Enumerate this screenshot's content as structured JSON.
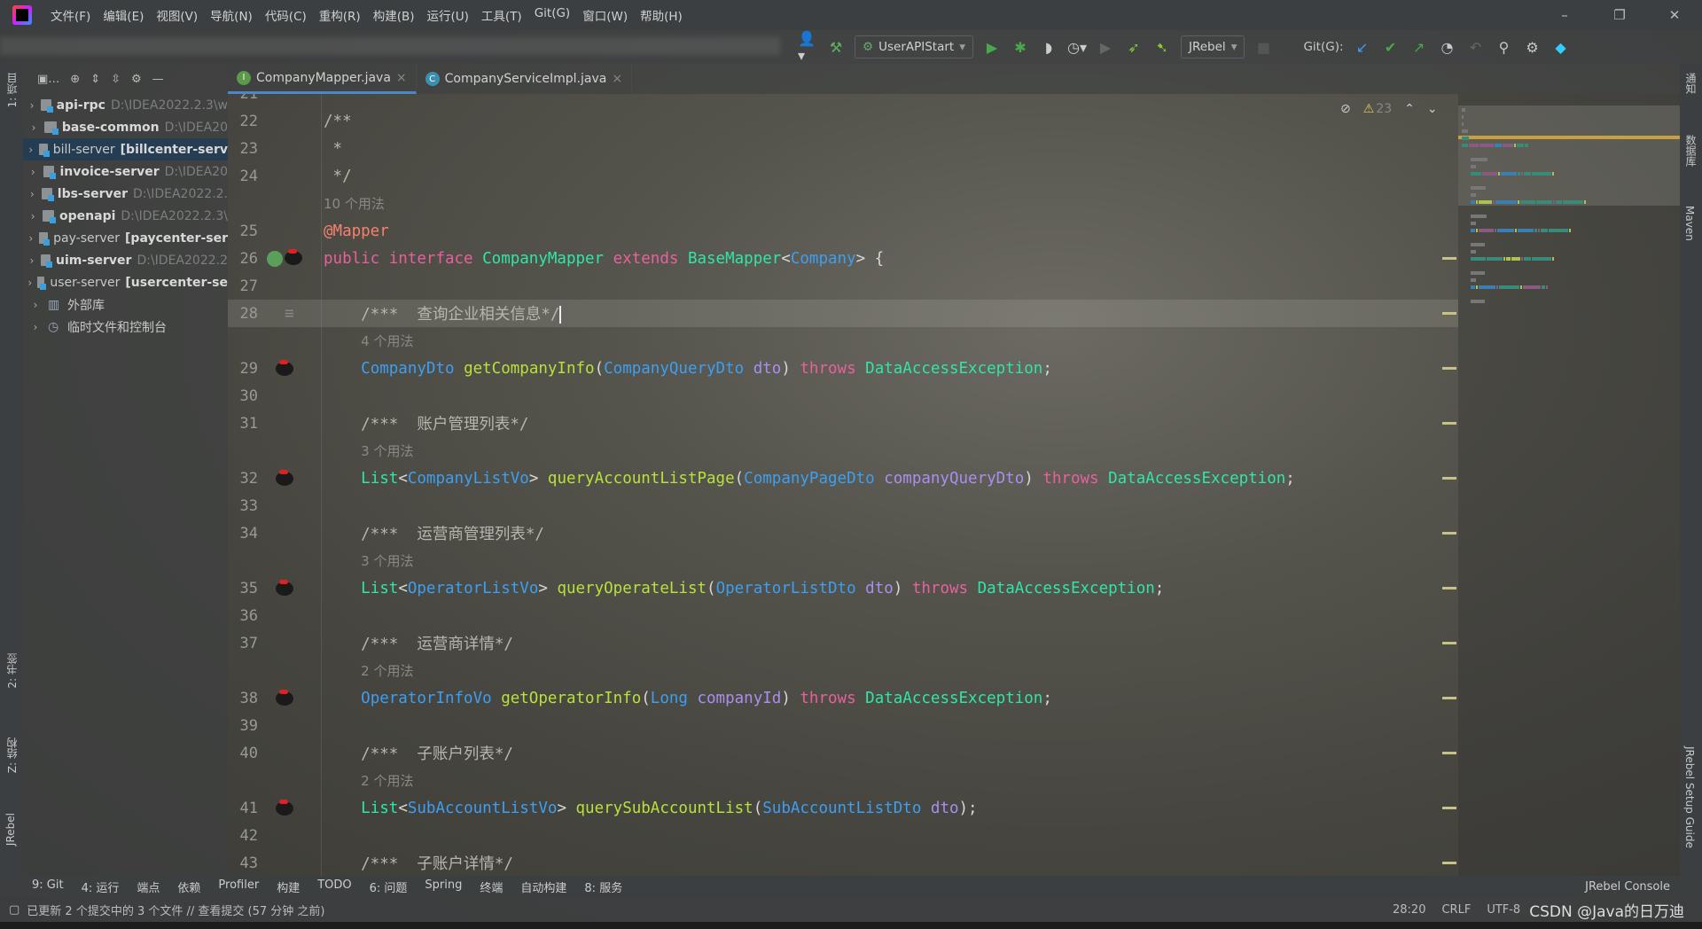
{
  "menu": [
    "文件(F)",
    "编辑(E)",
    "视图(V)",
    "导航(N)",
    "代码(C)",
    "重构(R)",
    "构建(B)",
    "运行(U)",
    "工具(T)",
    "Git(G)",
    "窗口(W)",
    "帮助(H)"
  ],
  "toolbar": {
    "run_config": "UserAPIStart",
    "jrebel": "JRebel",
    "git_label": "Git(G):"
  },
  "left_strip": {
    "project": "1: 项目",
    "bookmarks": "2: 书签",
    "structure": "Z: 结构",
    "jrebel": "JRebel"
  },
  "right_strip": {
    "notifications": "通知",
    "database": "数据库",
    "maven": "Maven",
    "jrebel_guide": "JRebel Setup Guide"
  },
  "project_tree": [
    {
      "name": "api-rpc",
      "suffix": "D:\\IDEA2022.2.3\\w",
      "bold": true
    },
    {
      "name": "base-common",
      "suffix": "D:\\IDEA20",
      "bold": true
    },
    {
      "name": "bill-server",
      "suffix": "[billcenter-serv",
      "bold": false,
      "selected": true
    },
    {
      "name": "invoice-server",
      "suffix": "D:\\IDEA20",
      "bold": true
    },
    {
      "name": "lbs-server",
      "suffix": "D:\\IDEA2022.2.",
      "bold": true
    },
    {
      "name": "openapi",
      "suffix": "D:\\IDEA2022.2.3\\",
      "bold": true
    },
    {
      "name": "pay-server",
      "suffix": "[paycenter-ser",
      "bold": false
    },
    {
      "name": "uim-server",
      "suffix": "D:\\IDEA2022.2",
      "bold": true
    },
    {
      "name": "user-server",
      "suffix": "[usercenter-se",
      "bold": false
    },
    {
      "name": "外部库",
      "suffix": "",
      "bold": false,
      "icon": "library"
    },
    {
      "name": "临时文件和控制台",
      "suffix": "",
      "bold": false,
      "icon": "scratch"
    }
  ],
  "tabs": [
    {
      "label": "CompanyMapper.java",
      "icon": "I",
      "active": true
    },
    {
      "label": "CompanyServiceImpl.java",
      "icon": "C",
      "active": false
    }
  ],
  "inspections": {
    "warnings": "23"
  },
  "code": [
    {
      "ln": "21",
      "tokens": []
    },
    {
      "ln": "22",
      "tokens": [
        [
          "/**",
          "cm"
        ]
      ]
    },
    {
      "ln": "23",
      "tokens": [
        [
          " *",
          "cm"
        ]
      ]
    },
    {
      "ln": "24",
      "tokens": [
        [
          " */",
          "cm"
        ]
      ]
    },
    {
      "ln": "",
      "tokens": [
        [
          "10 个用法",
          "u"
        ]
      ]
    },
    {
      "ln": "25",
      "tokens": [
        [
          "@Mapper",
          "a"
        ]
      ]
    },
    {
      "ln": "26",
      "gutter": "spring-bug",
      "tokens": [
        [
          "public ",
          "k"
        ],
        [
          "interface ",
          "k"
        ],
        [
          "CompanyMapper ",
          "c"
        ],
        [
          "extends ",
          "k"
        ],
        [
          "BaseMapper",
          "c"
        ],
        [
          "<",
          "pl"
        ],
        [
          "Company",
          "t"
        ],
        [
          "> {",
          "pl"
        ]
      ]
    },
    {
      "ln": "27",
      "tokens": []
    },
    {
      "ln": "28",
      "current": true,
      "tokens": [
        [
          "    /***  查询企业相关信息*/",
          "cm"
        ]
      ]
    },
    {
      "ln": "",
      "tokens": [
        [
          "    ",
          "pl"
        ],
        [
          "4 个用法",
          "u"
        ]
      ]
    },
    {
      "ln": "29",
      "gutter": "bug",
      "tokens": [
        [
          "    ",
          "pl"
        ],
        [
          "CompanyDto ",
          "t"
        ],
        [
          "getCompanyInfo",
          "m"
        ],
        [
          "(",
          "pl"
        ],
        [
          "CompanyQueryDto ",
          "t"
        ],
        [
          "dto",
          "p"
        ],
        [
          ") ",
          "pl"
        ],
        [
          "throws ",
          "k"
        ],
        [
          "DataAccessException",
          "c"
        ],
        [
          ";",
          "pl"
        ]
      ]
    },
    {
      "ln": "30",
      "tokens": []
    },
    {
      "ln": "31",
      "tokens": [
        [
          "    /***  账户管理列表*/",
          "cm"
        ]
      ]
    },
    {
      "ln": "",
      "tokens": [
        [
          "    ",
          "pl"
        ],
        [
          "3 个用法",
          "u"
        ]
      ]
    },
    {
      "ln": "32",
      "gutter": "bug",
      "tokens": [
        [
          "    ",
          "pl"
        ],
        [
          "List",
          "c"
        ],
        [
          "<",
          "pl"
        ],
        [
          "CompanyListVo",
          "t"
        ],
        [
          "> ",
          "pl"
        ],
        [
          "queryAccountListPage",
          "m"
        ],
        [
          "(",
          "pl"
        ],
        [
          "CompanyPageDto ",
          "t"
        ],
        [
          "companyQueryDto",
          "p"
        ],
        [
          ") ",
          "pl"
        ],
        [
          "throws ",
          "k"
        ],
        [
          "DataAccessException",
          "c"
        ],
        [
          ";",
          "pl"
        ]
      ]
    },
    {
      "ln": "33",
      "tokens": []
    },
    {
      "ln": "34",
      "tokens": [
        [
          "    /***  运营商管理列表*/",
          "cm"
        ]
      ]
    },
    {
      "ln": "",
      "tokens": [
        [
          "    ",
          "pl"
        ],
        [
          "3 个用法",
          "u"
        ]
      ]
    },
    {
      "ln": "35",
      "gutter": "bug",
      "tokens": [
        [
          "    ",
          "pl"
        ],
        [
          "List",
          "c"
        ],
        [
          "<",
          "pl"
        ],
        [
          "OperatorListVo",
          "t"
        ],
        [
          "> ",
          "pl"
        ],
        [
          "queryOperateList",
          "m"
        ],
        [
          "(",
          "pl"
        ],
        [
          "OperatorListDto ",
          "t"
        ],
        [
          "dto",
          "p"
        ],
        [
          ") ",
          "pl"
        ],
        [
          "throws ",
          "k"
        ],
        [
          "DataAccessException",
          "c"
        ],
        [
          ";",
          "pl"
        ]
      ]
    },
    {
      "ln": "36",
      "tokens": []
    },
    {
      "ln": "37",
      "tokens": [
        [
          "    /***  运营商详情*/",
          "cm"
        ]
      ]
    },
    {
      "ln": "",
      "tokens": [
        [
          "    ",
          "pl"
        ],
        [
          "2 个用法",
          "u"
        ]
      ]
    },
    {
      "ln": "38",
      "gutter": "bug",
      "tokens": [
        [
          "    ",
          "pl"
        ],
        [
          "OperatorInfoVo ",
          "t"
        ],
        [
          "getOperatorInfo",
          "m"
        ],
        [
          "(",
          "pl"
        ],
        [
          "Long ",
          "t"
        ],
        [
          "companyId",
          "p"
        ],
        [
          ") ",
          "pl"
        ],
        [
          "throws ",
          "k"
        ],
        [
          "DataAccessException",
          "c"
        ],
        [
          ";",
          "pl"
        ]
      ]
    },
    {
      "ln": "39",
      "tokens": []
    },
    {
      "ln": "40",
      "tokens": [
        [
          "    /***  子账户列表*/",
          "cm"
        ]
      ]
    },
    {
      "ln": "",
      "tokens": [
        [
          "    ",
          "pl"
        ],
        [
          "2 个用法",
          "u"
        ]
      ]
    },
    {
      "ln": "41",
      "gutter": "bug",
      "tokens": [
        [
          "    ",
          "pl"
        ],
        [
          "List",
          "c"
        ],
        [
          "<",
          "pl"
        ],
        [
          "SubAccountListVo",
          "t"
        ],
        [
          "> ",
          "pl"
        ],
        [
          "querySubAccountList",
          "m"
        ],
        [
          "(",
          "pl"
        ],
        [
          "SubAccountListDto ",
          "t"
        ],
        [
          "dto",
          "p"
        ],
        [
          ");",
          "pl"
        ]
      ]
    },
    {
      "ln": "42",
      "tokens": []
    },
    {
      "ln": "43",
      "tokens": [
        [
          "    /***  子账户详情*/",
          "cm"
        ]
      ]
    }
  ],
  "bottom_tools": [
    "9: Git",
    "4: 运行",
    "端点",
    "依赖",
    "Profiler",
    "构建",
    "TODO",
    "6: 问题",
    "Spring",
    "终端",
    "自动构建",
    "8: 服务"
  ],
  "jrebel_console": "JRebel Console",
  "status": {
    "message": "已更新 2 个提交中的 3 个文件 // 查看提交 (57 分钟 之前)",
    "position": "28:20",
    "line_sep": "CRLF",
    "encoding": "UTF-8",
    "watermark": "CSDN @Java的日万迪"
  },
  "colors": {
    "keyword": "#e8609e",
    "class": "#2ee6a8",
    "type": "#3c9ff2",
    "method": "#b8e23a",
    "param": "#a98ef0",
    "accent": "#4a88c7"
  }
}
